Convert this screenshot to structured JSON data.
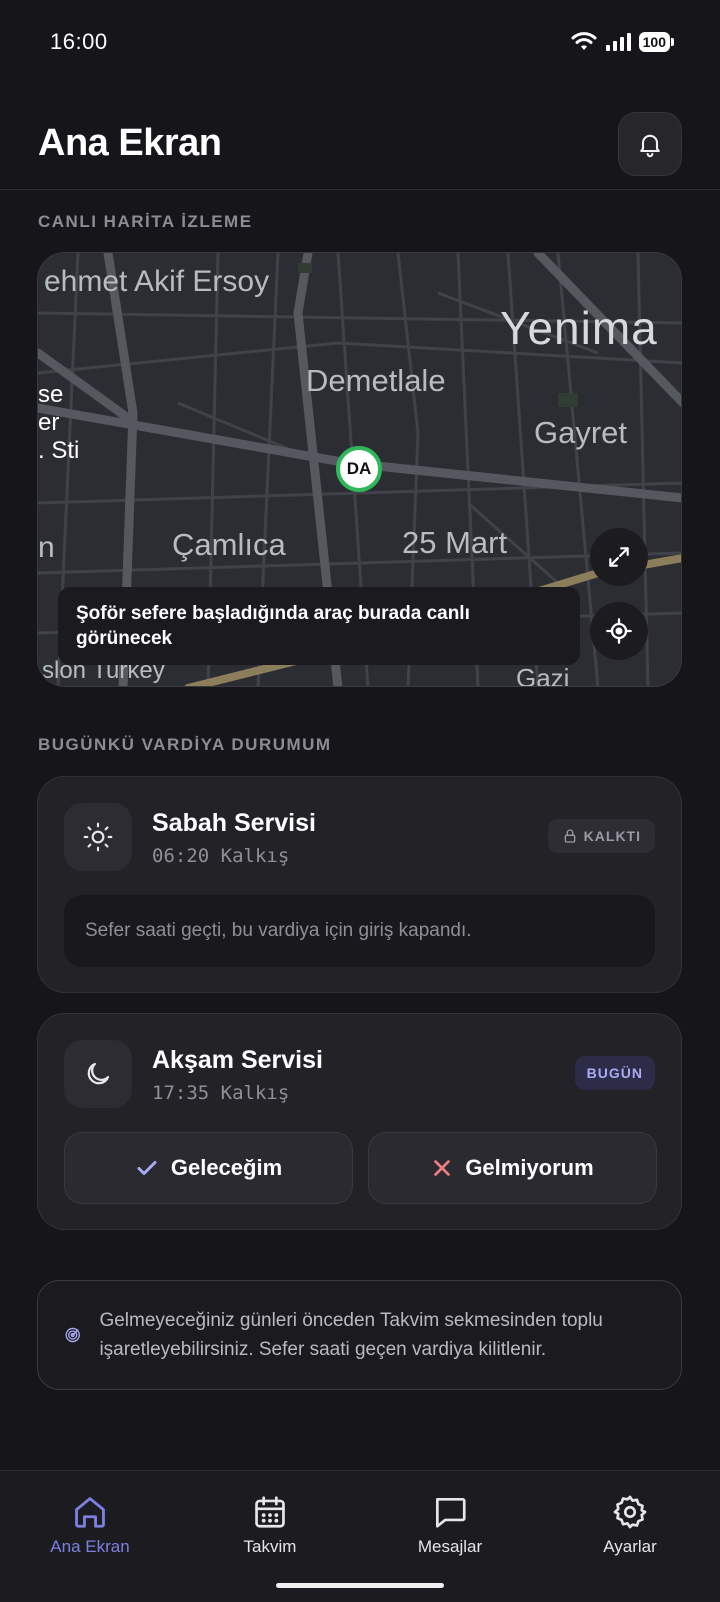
{
  "status_bar": {
    "time": "16:00",
    "battery": "100"
  },
  "header": {
    "title": "Ana Ekran",
    "icon": "bell-icon"
  },
  "live_map": {
    "section_label": "CANLI HARİTA İZLEME",
    "labels": {
      "street_top": "ehmet Akif Ersoy",
      "district_right": "Yenima",
      "district_center": "Demetlale",
      "district_gayret": "Gayret",
      "district_camlica": "Çamlıca",
      "district_25mart": "25 Mart",
      "district_gazi": "Gazi",
      "poi_left_1": "se",
      "poi_left_2": "er",
      "poi_left_3": ". Sti",
      "poi_left_4": "n",
      "poi_bottom": "sloh Turkey"
    },
    "driver_marker": "DA",
    "message": "Şoför sefere başladığında araç burada canlı görünecek",
    "expand_icon": "expand-icon",
    "locate_icon": "locate-icon"
  },
  "shifts": {
    "section_label": "BUGÜNKÜ VARDİYA DURUMUM",
    "morning": {
      "icon": "sun-icon",
      "title": "Sabah Servisi",
      "time": "06:20 Kalkış",
      "badge": "KALKTI",
      "notice": "Sefer saati geçti, bu vardiya için giriş kapandı."
    },
    "evening": {
      "icon": "moon-icon",
      "title": "Akşam Servisi",
      "time": "17:35 Kalkış",
      "badge": "BUGÜN",
      "attend_label": "Geleceğim",
      "decline_label": "Gelmiyorum"
    }
  },
  "info": {
    "icon": "radar-icon",
    "text": "Gelmeyeceğiniz günleri önceden Takvim sekmesinden toplu işaretleyebilirsiniz. Sefer saati geçen vardiya kilitlenir."
  },
  "nav": {
    "home": "Ana Ekran",
    "calendar": "Takvim",
    "messages": "Mesajlar",
    "settings": "Ayarlar"
  },
  "colors": {
    "accent": "#7b7fe0",
    "driver_ring": "#2fb85a",
    "decline": "#f08080",
    "background": "#16161a"
  }
}
